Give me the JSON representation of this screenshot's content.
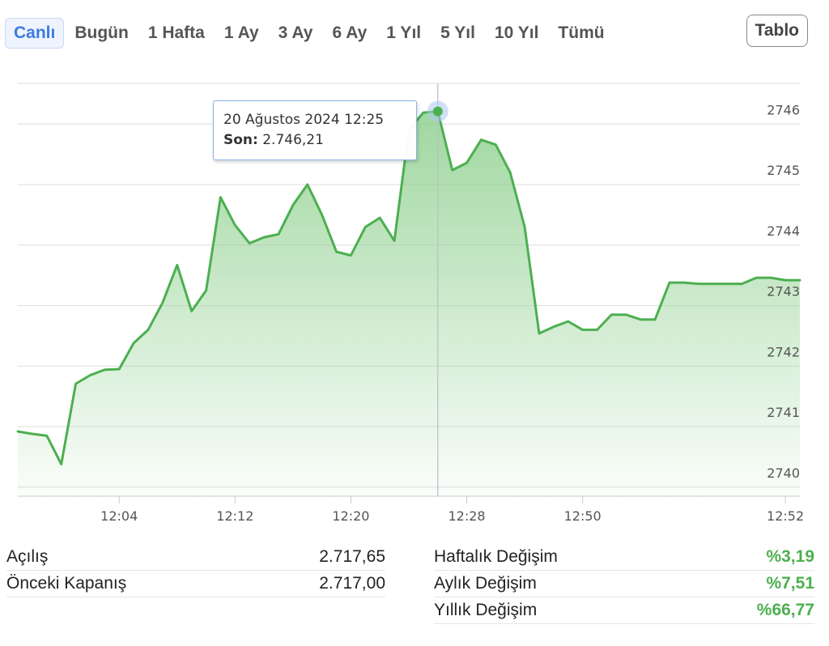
{
  "ranges": [
    "Canlı",
    "Bugün",
    "1 Hafta",
    "1 Ay",
    "3 Ay",
    "6 Ay",
    "1 Yıl",
    "5 Yıl",
    "10 Yıl",
    "Tümü"
  ],
  "active_range": "Canlı",
  "table_button": "Tablo",
  "tooltip": {
    "date": "20 Ağustos 2024 12:25",
    "label": "Son:",
    "value": "2.746,21"
  },
  "colors": {
    "line": "#4caf50",
    "fill_top": "#8fd08f",
    "accent": "#3d7be0",
    "positive": "#4caf50"
  },
  "chart_data": {
    "type": "area",
    "x_tick_labels": [
      "12:04",
      "12:12",
      "12:20",
      "12:28",
      "12:50",
      "12:52"
    ],
    "x_tick_positions": [
      7,
      15,
      23,
      31,
      39,
      53
    ],
    "y_ticks": [
      2740,
      2741,
      2742,
      2743,
      2744,
      2745,
      2746
    ],
    "ylim": [
      2739.85,
      2746.9
    ],
    "highlight_index": 29,
    "values": [
      2740.92,
      2740.88,
      2740.85,
      2740.38,
      2741.71,
      2741.85,
      2741.94,
      2741.95,
      2742.38,
      2742.6,
      2743.05,
      2743.67,
      2742.91,
      2743.25,
      2744.79,
      2744.33,
      2744.03,
      2744.13,
      2744.18,
      2744.66,
      2745.0,
      2744.5,
      2743.89,
      2743.83,
      2744.3,
      2744.45,
      2744.07,
      2745.9,
      2746.19,
      2746.21,
      2745.24,
      2745.36,
      2745.74,
      2745.66,
      2745.2,
      2744.3,
      2742.54,
      2742.65,
      2742.74,
      2742.6,
      2742.6,
      2742.85,
      2742.85,
      2742.77,
      2742.77,
      2743.38,
      2743.38,
      2743.36,
      2743.36,
      2743.36,
      2743.36,
      2743.46,
      2743.46,
      2743.42,
      2743.42
    ]
  },
  "stats_left": [
    {
      "label": "Açılış",
      "value": "2.717,65"
    },
    {
      "label": "Önceki Kapanış",
      "value": "2.717,00"
    }
  ],
  "stats_right": [
    {
      "label": "Haftalık Değişim",
      "value": "%3,19"
    },
    {
      "label": "Aylık Değişim",
      "value": "%7,51"
    },
    {
      "label": "Yıllık Değişim",
      "value": "%66,77"
    }
  ]
}
